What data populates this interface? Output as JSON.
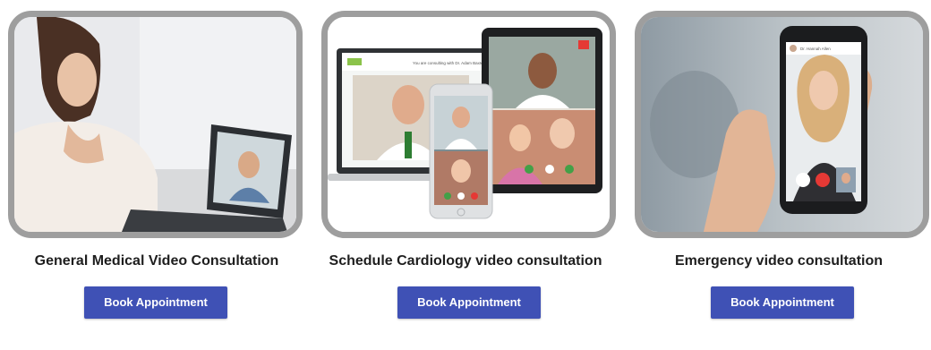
{
  "cards": [
    {
      "image_label": "woman on laptop video call with doctor",
      "title": "General Medical Video Consultation",
      "button_label": "Book Appointment"
    },
    {
      "image_label": "video consultation on laptop, tablet and phone",
      "title": "Schedule Cardiology video consultation",
      "button_label": "Book Appointment",
      "screen_text": "You are consulting with Dr. Adam Baxter"
    },
    {
      "image_label": "hand holding phone with doctor video call",
      "title": "Emergency video consultation",
      "button_label": "Book Appointment",
      "screen_text": "Dr. Hannah Allen"
    }
  ]
}
